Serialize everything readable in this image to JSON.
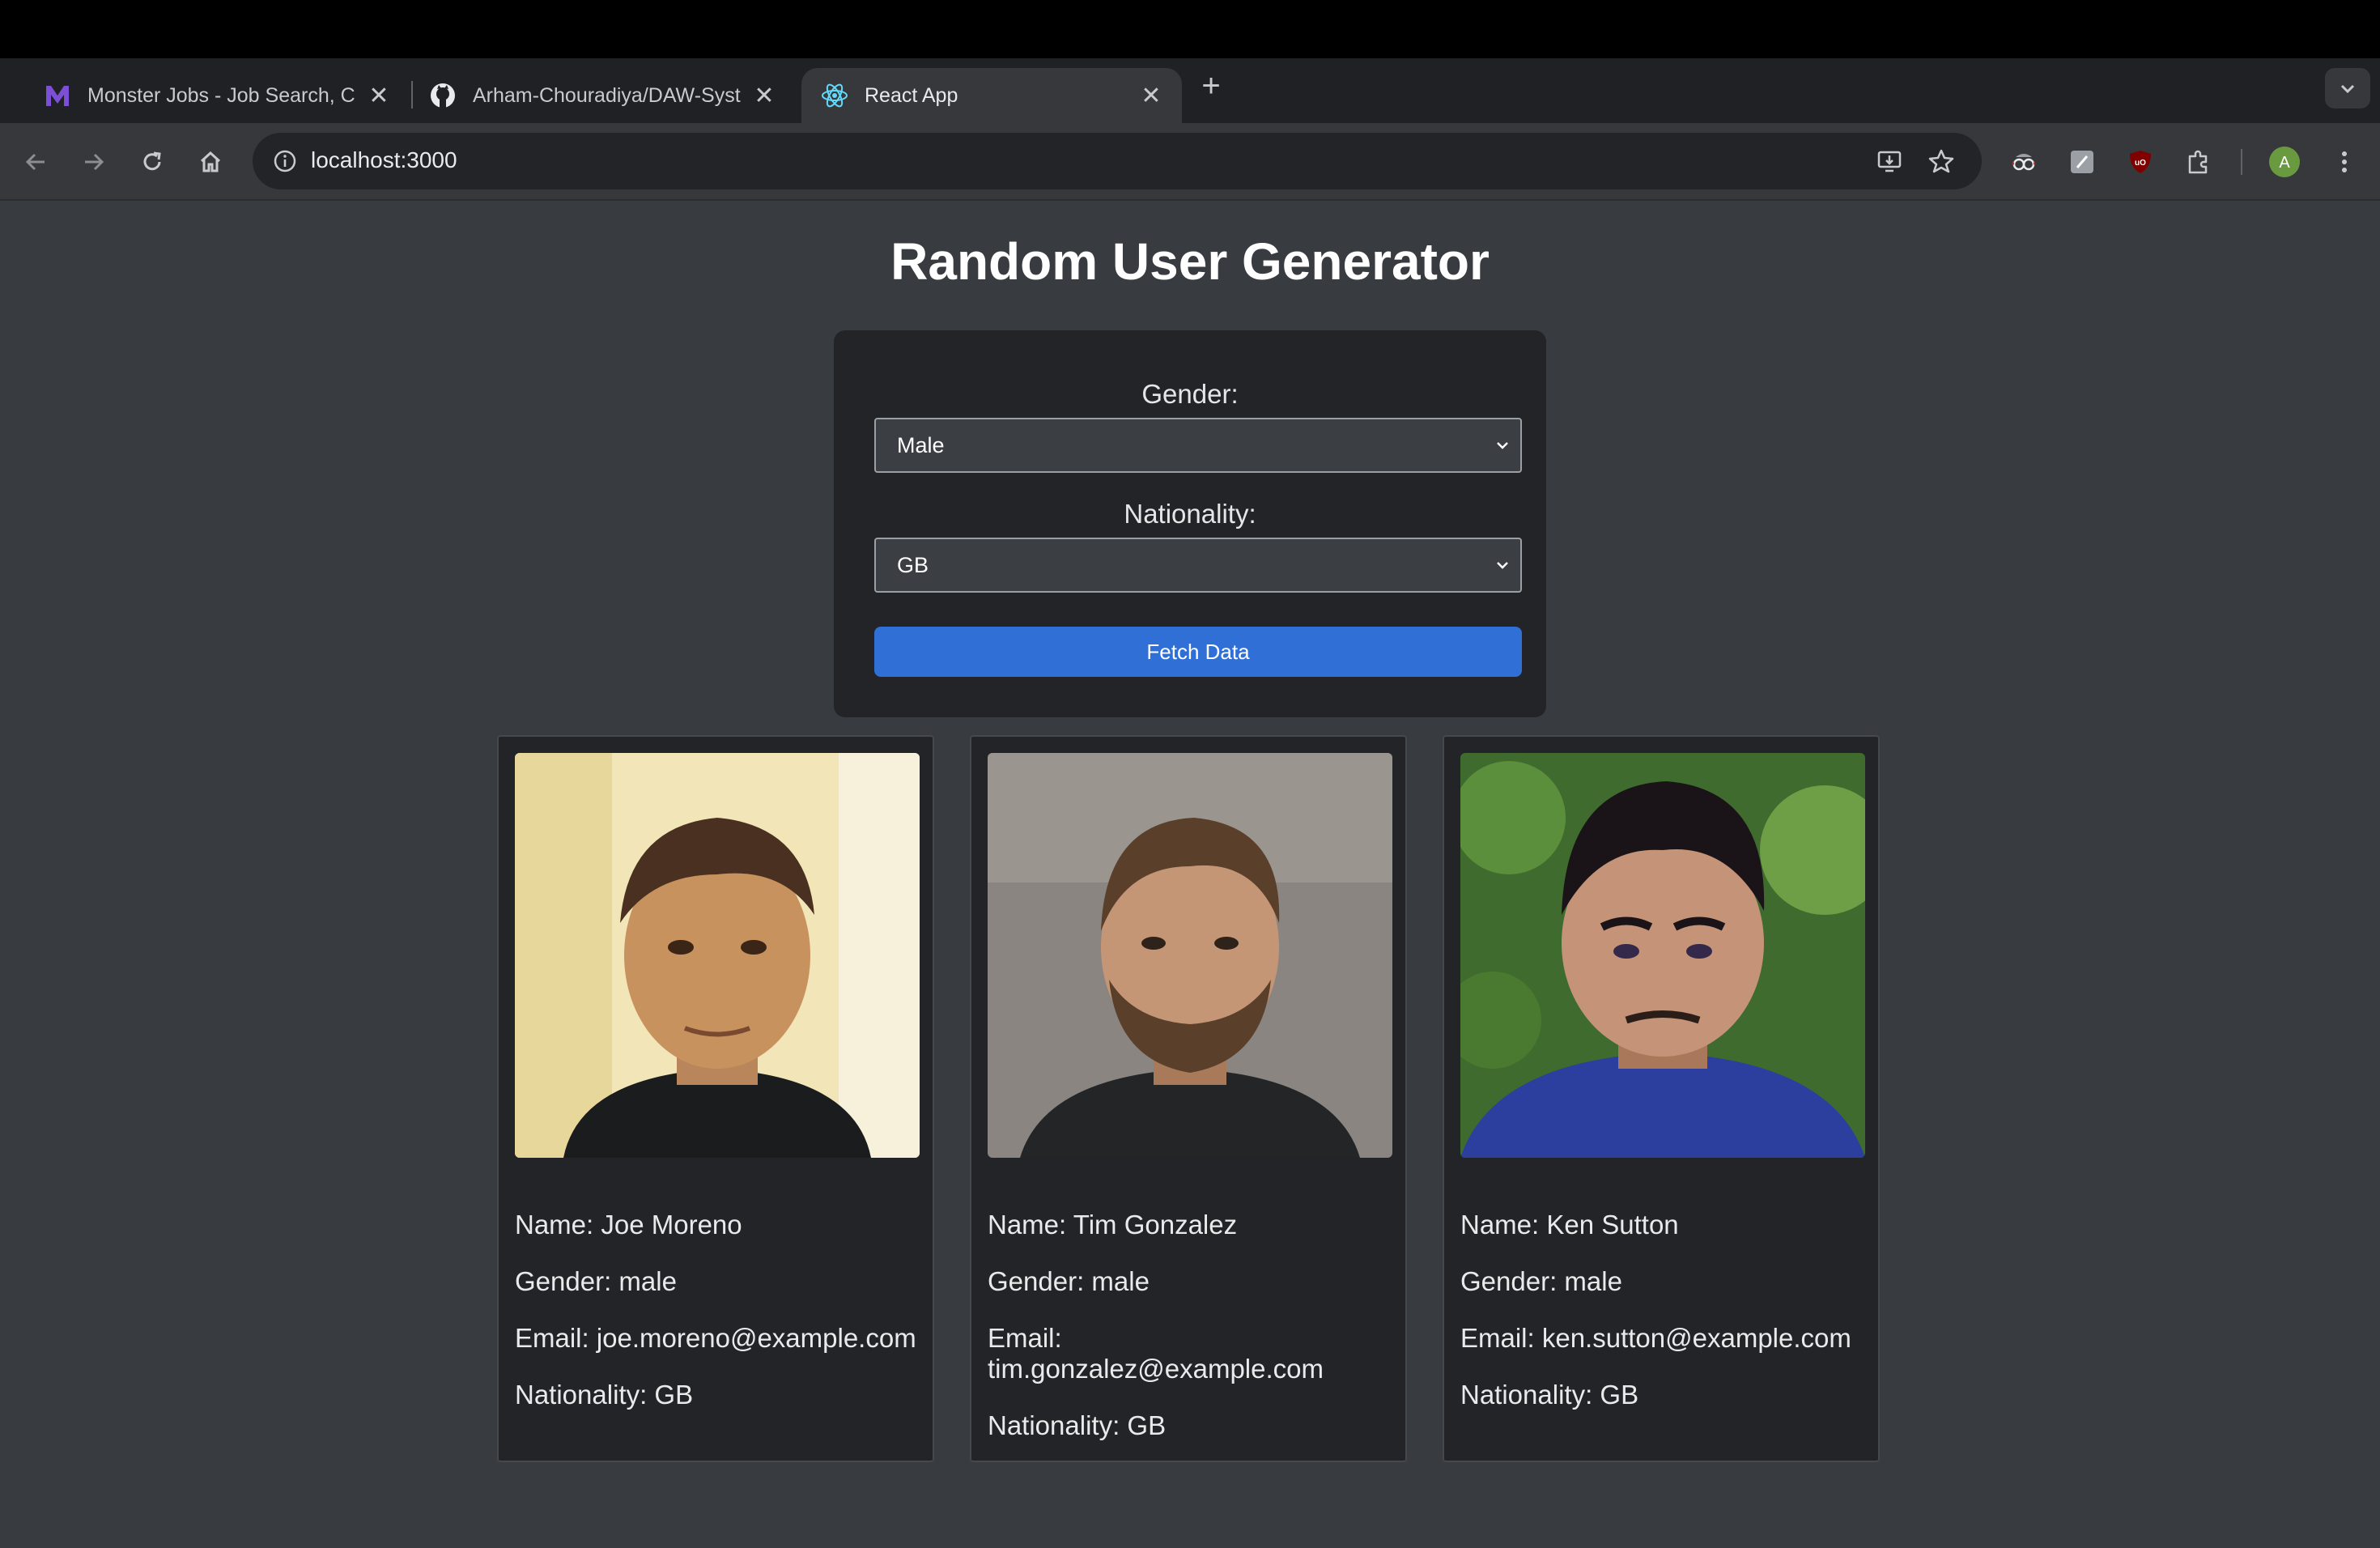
{
  "browser": {
    "tabs": [
      {
        "title": "Monster Jobs - Job Search, C",
        "icon": "monster-icon",
        "active": false
      },
      {
        "title": "Arham-Chouradiya/DAW-Syst",
        "icon": "github-icon",
        "active": false
      },
      {
        "title": "React App",
        "icon": "react-icon",
        "active": true
      }
    ],
    "url": "localhost:3000",
    "profile_initial": "A",
    "accent_profile": "#6a9a3f",
    "accent_monster": "#6e46c8"
  },
  "page": {
    "title": "Random User Generator",
    "form": {
      "gender_label": "Gender:",
      "gender_value": "Male",
      "nationality_label": "Nationality:",
      "nationality_value": "GB",
      "fetch_label": "Fetch Data",
      "button_color": "#2f6fd6"
    },
    "users": [
      {
        "name": "Name: Joe Moreno",
        "gender": "Gender: male",
        "email": "Email: joe.moreno@example.com",
        "nationality": "Nationality: GB"
      },
      {
        "name": "Name: Tim Gonzalez",
        "gender": "Gender: male",
        "email_label": "Email:",
        "email_value": "tim.gonzalez@example.com",
        "nationality": "Nationality: GB"
      },
      {
        "name": "Name: Ken Sutton",
        "gender": "Gender: male",
        "email": "Email: ken.sutton@example.com",
        "nationality": "Nationality: GB"
      }
    ]
  }
}
